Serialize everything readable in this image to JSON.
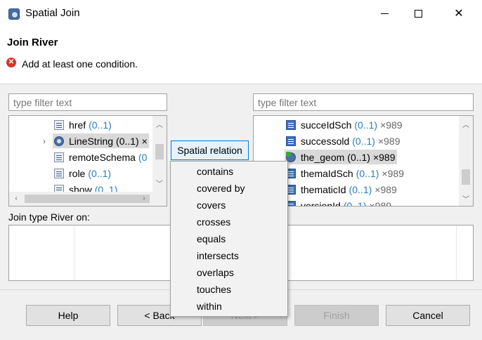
{
  "window": {
    "title": "Spatial Join"
  },
  "header": {
    "title": "Join River",
    "message": "Add at least one condition."
  },
  "left_panel": {
    "filter_placeholder": "type filter text",
    "rows": [
      {
        "label": "href",
        "mult": "(0..1)",
        "count": "",
        "icon": "property-icon",
        "selected": false
      },
      {
        "label": "LineString",
        "mult": "(0..1) ×",
        "count": "",
        "icon": "geometry-icon",
        "selected": true,
        "expander": "›"
      },
      {
        "label": "remoteSchema",
        "mult": "(0",
        "count": "",
        "icon": "property-icon",
        "selected": false
      },
      {
        "label": "role",
        "mult": "(0..1)",
        "count": "",
        "icon": "property-icon",
        "selected": false
      },
      {
        "label": "show",
        "mult": "(0..1)",
        "count": "",
        "icon": "property-icon",
        "selected": false
      }
    ]
  },
  "right_panel": {
    "filter_placeholder": "type filter text",
    "rows": [
      {
        "label": "succeIdSch",
        "mult": "(0..1)",
        "count": "×989",
        "icon": "list-icon",
        "selected": false
      },
      {
        "label": "successold",
        "mult": "(0..1)",
        "count": "×989",
        "icon": "list-icon",
        "selected": false
      },
      {
        "label": "the_geom",
        "mult": "(0..1)",
        "count": "×989",
        "icon": "geometry-icon",
        "selected": true
      },
      {
        "label": "themaIdSch",
        "mult": "(0..1)",
        "count": "×989",
        "icon": "list-icon",
        "selected": false
      },
      {
        "label": "thematicId",
        "mult": "(0..1)",
        "count": "×989",
        "icon": "list-icon",
        "selected": false
      },
      {
        "label": "versionId",
        "mult": "(0..1)",
        "count": "×989",
        "icon": "list-icon",
        "selected": false
      }
    ]
  },
  "spatial_button": {
    "label": "Spatial relation"
  },
  "join_label": "Join type River on:",
  "menu": {
    "items": [
      "contains",
      "covered by",
      "covers",
      "crosses",
      "equals",
      "intersects",
      "overlaps",
      "touches",
      "within"
    ]
  },
  "footer": {
    "help": "Help",
    "back": "< Back",
    "next": "Next >",
    "finish": "Finish",
    "cancel": "Cancel"
  },
  "colors": {
    "accent": "#0078d7",
    "multiplicity": "#2a7bbf",
    "error": "#d9342b"
  }
}
